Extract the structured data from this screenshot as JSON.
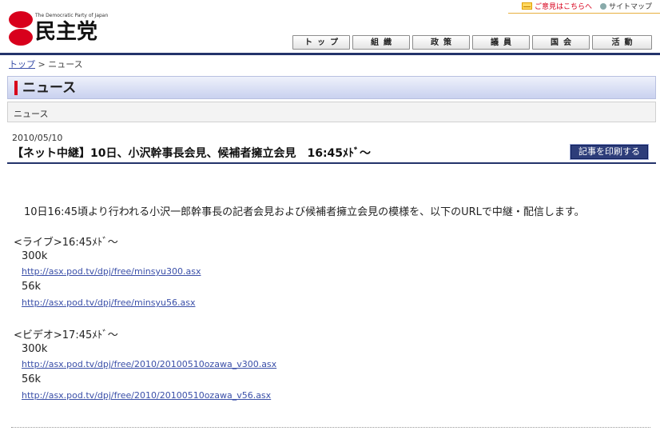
{
  "header": {
    "logo_small": "The Democratic Party of Japan",
    "logo_text": "民主党",
    "util": [
      {
        "label": "ご意見はこちらへ"
      },
      {
        "label": "サイトマップ"
      }
    ],
    "nav": [
      {
        "label": "トップ"
      },
      {
        "label": "組織"
      },
      {
        "label": "政策"
      },
      {
        "label": "議員"
      },
      {
        "label": "国会"
      },
      {
        "label": "活動"
      }
    ]
  },
  "breadcrumb": {
    "home": "トップ",
    "separator": ">",
    "current": "ニュース"
  },
  "section": {
    "title": "ニュース",
    "sub": "ニュース"
  },
  "article": {
    "date": "2010/05/10",
    "title": "【ネット中継】10日、小沢幹事長会見、候補者擁立会見　16:45ﾒﾄﾞ～",
    "print_label": "記事を印刷する",
    "intro": "10日16:45頃より行われる小沢一郎幹事長の記者会見および候補者擁立会見の模様を、以下のURLで中継・配信します。",
    "live": {
      "heading": "<ライブ>16:45ﾒﾄﾞ～",
      "items": [
        {
          "quality": "300k",
          "url": "http://asx.pod.tv/dpj/free/minsyu300.asx"
        },
        {
          "quality": "56k",
          "url": "http://asx.pod.tv/dpj/free/minsyu56.asx"
        }
      ]
    },
    "video": {
      "heading": "<ビデオ>17:45ﾒﾄﾞ～",
      "items": [
        {
          "quality": "300k",
          "url": "http://asx.pod.tv/dpj/free/2010/20100510ozawa_v300.asx"
        },
        {
          "quality": "56k",
          "url": "http://asx.pod.tv/dpj/free/2010/20100510ozawa_v56.asx"
        }
      ]
    }
  },
  "colors": {
    "brand_red": "#d8001c",
    "navy": "#24336b",
    "link": "#3a4fa8"
  }
}
